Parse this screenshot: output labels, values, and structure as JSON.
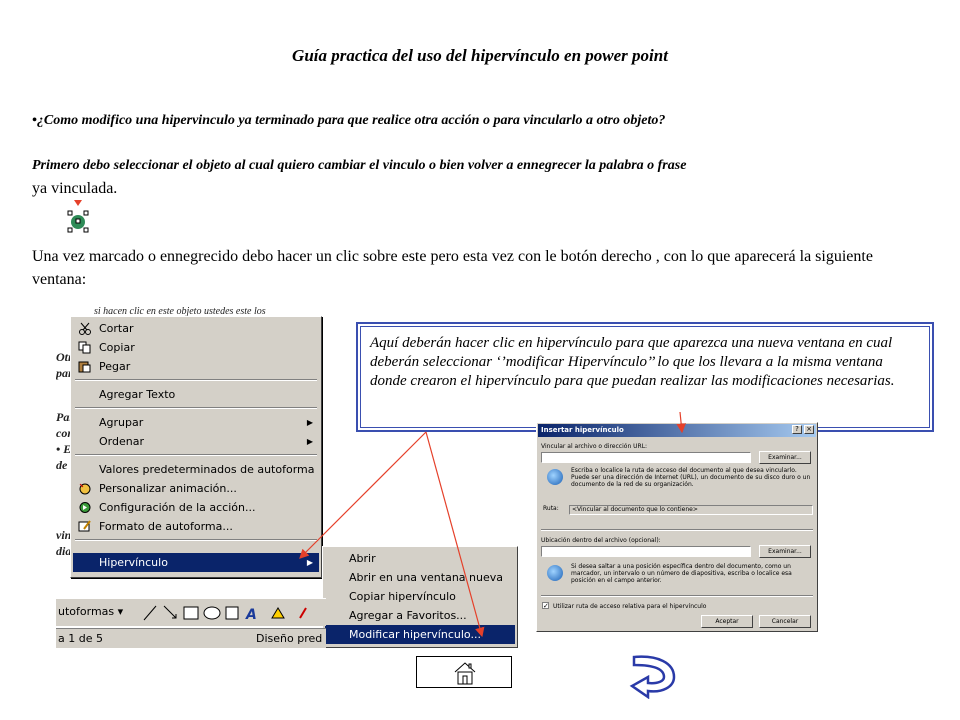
{
  "title": "Guía practica del uso del hipervínculo en power point",
  "question": "•¿Como modifico una hipervinculo ya terminado para que realice otra acción o para vincularlo a otro objeto?",
  "step1_bold": "Primero debo seleccionar el objeto al cual quiero cambiar el vinculo o bien volver a ennegrecer la palabra o frase",
  "step1_tail": "ya vinculada.",
  "step2": "Una vez marcado o ennegrecido debo hacer un clic sobre este pero esta vez con le botón derecho , con lo que aparecerá la siguiente ventana:",
  "callout": "Aquí deberán hacer clic en hipervínculo para que aparezca una nueva ventana en cual deberán seleccionar ‘’modificar Hipervínculo’’ lo que los llevara a la misma ventana donde crearon el hipervínculo para que puedan realizar las modificaciones necesarias.",
  "context_menu": {
    "items": [
      {
        "label": "Cortar",
        "icon": "scissors-icon"
      },
      {
        "label": "Copiar",
        "icon": "copy-icon"
      },
      {
        "label": "Pegar",
        "icon": "paste-icon"
      },
      {
        "label": "Agregar Texto",
        "icon": ""
      },
      {
        "label": "Agrupar",
        "icon": "",
        "submenu": true
      },
      {
        "label": "Ordenar",
        "icon": "",
        "submenu": true
      },
      {
        "label": "Valores predeterminados de autoforma",
        "icon": ""
      },
      {
        "label": "Personalizar animación...",
        "icon": "animation-icon"
      },
      {
        "label": "Configuración de la acción...",
        "icon": "action-icon"
      },
      {
        "label": "Formato de autoforma...",
        "icon": "format-icon"
      },
      {
        "label": "Hipervínculo",
        "icon": "",
        "submenu": true,
        "highlighted": true
      }
    ]
  },
  "submenu": {
    "items": [
      "Abrir",
      "Abrir en una ventana nueva",
      "Copiar hipervínculo",
      "Agregar a Favoritos...",
      "Modificar hipervínculo..."
    ]
  },
  "background_fragments": {
    "top": "si hacen clic en este objeto ustedes este los",
    "left": [
      "Otr",
      "par",
      "Par",
      "con",
      "• E",
      "de",
      "vin",
      "dia"
    ]
  },
  "toolbar_label": "utoformas ▾",
  "status_left": "a 1 de 5",
  "status_right": "Diseño pred",
  "dialog": {
    "title": "Insertar hipervínculo",
    "label_url": "Vincular al archivo o dirección URL:",
    "browse1": "Examinar...",
    "help1": "Escriba o localice la ruta de acceso del documento al que desea vincularlo. Puede ser una dirección de Internet (URL), un documento de su disco duro o un documento de la red de su organización.",
    "ruta_label": "Ruta:",
    "ruta_value": "<Vincular al documento que lo contiene>",
    "label_location": "Ubicación dentro del archivo (opcional):",
    "browse2": "Examinar...",
    "help2": "Si desea saltar a una posición específica dentro del documento, como un marcador, un intervalo o un número de diapositiva, escriba o localice esa posición en el campo anterior.",
    "checkbox": "Utilizar ruta de acceso relativa para el hipervínculo",
    "ok": "Aceptar",
    "cancel": "Cancelar",
    "title_buttons": [
      "?",
      "×"
    ]
  },
  "colors": {
    "accent_blue": "#3a4fb0",
    "arrow_red": "#e5402a",
    "menu_highlight": "#0a246a",
    "nav_arrow": "#2a3aa8"
  }
}
